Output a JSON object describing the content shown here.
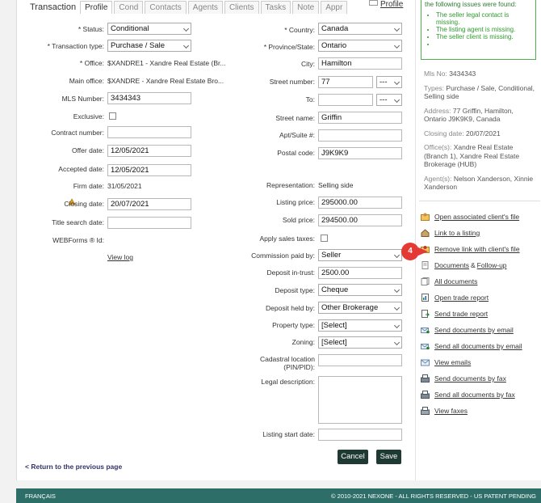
{
  "tabs": {
    "title": "Transaction",
    "items": [
      "Profile",
      "Cond",
      "Contacts",
      "Agents",
      "Clients",
      "Tasks",
      "Note",
      "Appr"
    ],
    "profile_link": "Profile"
  },
  "form_left": {
    "status_label": "* Status:",
    "status_value": "Conditional",
    "type_label": "* Transaction type:",
    "type_value": "Purchase / Sale",
    "office_label": "* Office:",
    "office_value": "$XANDRE1 - Xandre Real Estate (Br...",
    "main_office_label": "Main office:",
    "main_office_value": "$XANDRE - Xandre Real Estate Bro...",
    "mls_label": "MLS Number:",
    "mls_value": "3434343",
    "exclusive_label": "Exclusive:",
    "contract_label": "Contract number:",
    "contract_value": "",
    "offer_label": "Offer date:",
    "offer_value": "12/05/2021",
    "accepted_label": "Accepted date:",
    "accepted_value": "12/05/2021",
    "firm_label": "Firm date:",
    "firm_value": "31/05/2021",
    "closing_label": "Closing date:",
    "closing_value": "20/07/2021",
    "title_search_label": "Title search date:",
    "title_search_value": "",
    "webforms_label": "WEBForms ® Id:",
    "view_log": "View log"
  },
  "form_right": {
    "country_label": "* Country:",
    "country_value": "Canada",
    "province_label": "* Province/State:",
    "province_value": "Ontario",
    "city_label": "City:",
    "city_value": "Hamilton",
    "street_number_label": "Street number:",
    "street_number_value": "77",
    "street_number_suffix": "---",
    "to_label": "To:",
    "to_value": "",
    "to_suffix": "---",
    "street_name_label": "Street name:",
    "street_name_value": "Griffin",
    "apt_label": "Apt/Suite #:",
    "apt_value": "",
    "postal_label": "Postal code:",
    "postal_value": "J9K9K9",
    "representation_label": "Representation:",
    "representation_value": "Selling side",
    "listing_price_label": "Listing price:",
    "listing_price_value": "295000.00",
    "sold_price_label": "Sold price:",
    "sold_price_value": "294500.00",
    "apply_tax_label": "Apply sales taxes:",
    "commission_label": "Commission paid by:",
    "commission_value": "Seller",
    "deposit_trust_label": "Deposit in-trust:",
    "deposit_trust_value": "2500.00",
    "deposit_type_label": "Deposit type:",
    "deposit_type_value": "Cheque",
    "deposit_held_label": "Deposit held by:",
    "deposit_held_value": "Other Brokerage",
    "property_type_label": "Property type:",
    "property_type_value": "[Select]",
    "zoning_label": "Zoning:",
    "zoning_value": "[Select]",
    "cadastral_label_1": "Cadastral location",
    "cadastral_label_2": "(PIN/PID):",
    "cadastral_value": "",
    "legal_label": "Legal description:",
    "listing_start_label": "Listing start date:",
    "listing_start_value": ""
  },
  "buttons": {
    "cancel": "Cancel",
    "save": "Save",
    "back": "< Return to the previous page"
  },
  "issues": {
    "title": "the following issues were found:",
    "items": [
      "The seller legal contact is missing.",
      "The listing agent is missing.",
      "The seller client is missing.",
      ""
    ]
  },
  "summary": {
    "mls_label": "Mls No:",
    "mls_value": "3434343",
    "types_label": "Types:",
    "types_value": "Purchase / Sale, Conditional, Selling side",
    "address_label": "Address:",
    "address_value": "77 Griffin, Hamilton, Ontario J9K9K9, Canada",
    "closing_label": "Closing date:",
    "closing_value": "20/07/2021",
    "offices_label": "Office(s):",
    "offices_value": "Xandre Real Estate (Branch 1), Xandre Real Estate Brokerage (HUB)",
    "agents_label": "Agent(s):",
    "agents_value": "Nelson Xanderson, Xinnie Xanderson"
  },
  "actions": {
    "open_client_file": "Open associated client's file",
    "link_listing": "Link to a listing",
    "remove_link": "Remove link with client's file",
    "documents": "Documents",
    "amp": "&",
    "follow_up": "Follow-up",
    "all_documents": "All documents",
    "open_trade_report": "Open trade report",
    "send_trade_report": "Send trade report",
    "send_docs_email": "Send documents by email",
    "send_all_docs_email": "Send all documents by email",
    "view_emails": "View emails",
    "send_docs_fax": "Send documents by fax",
    "send_all_docs_fax": "Send all documents by fax",
    "view_faxes": "View faxes"
  },
  "badge": "4",
  "footer": {
    "language": "FRANÇAIS",
    "copyright": "© 2010-2021 NEXONE - ALL RIGHTS RESERVED - US PATENT PENDING"
  },
  "colors": {
    "accent": "#1f3a33",
    "footer": "#2d6e68",
    "issues": "#4caf50",
    "badge": "#e53935"
  }
}
